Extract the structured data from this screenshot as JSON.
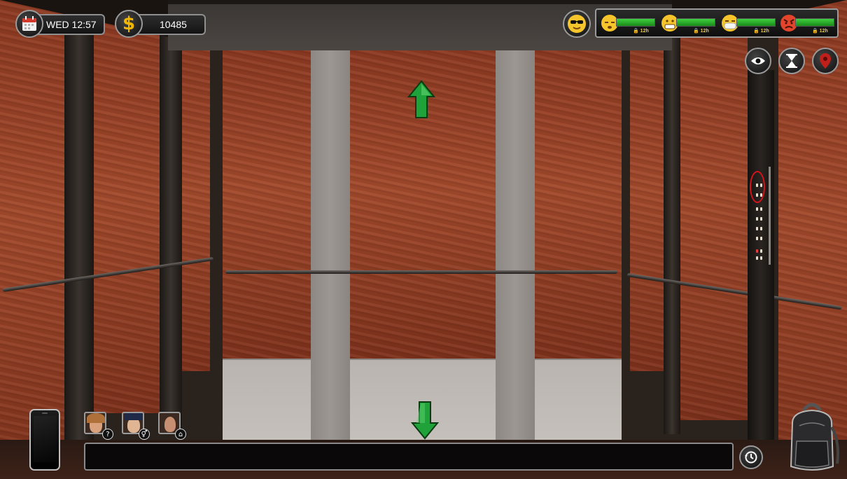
{
  "hud": {
    "date": "WED 12:57",
    "money": "10485"
  },
  "moods": [
    {
      "name": "sleepy",
      "time": "12h",
      "level": 1.0
    },
    {
      "name": "grinning",
      "time": "12h",
      "level": 1.0
    },
    {
      "name": "sick",
      "time": "12h",
      "level": 1.0
    },
    {
      "name": "angry",
      "time": "12h",
      "level": 1.0
    }
  ],
  "contacts": [
    {
      "name": "contact-1",
      "badge": "?"
    },
    {
      "name": "contact-2",
      "badge": "⚥"
    },
    {
      "name": "contact-3",
      "badge": "⌂"
    }
  ],
  "icons": {
    "calendar": "calendar-icon",
    "money": "dollar-icon",
    "mood": "sunglasses-face-icon",
    "eye": "eye-icon",
    "hourglass": "hourglass-icon",
    "location": "map-pin-icon",
    "history": "history-icon",
    "phone": "phone-icon",
    "backpack": "backpack-icon",
    "up": "arrow-up-icon",
    "down": "arrow-down-icon"
  },
  "colors": {
    "arrow_green": "#1fa23a",
    "mood_bar": "#2fb82f",
    "dollar": "#f2b705",
    "pin": "#c0201a"
  }
}
